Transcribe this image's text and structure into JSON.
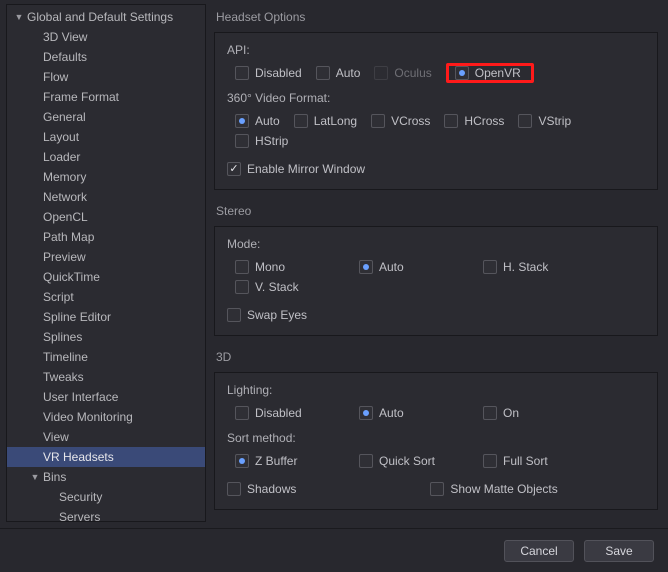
{
  "sidebar": {
    "root": {
      "label": "Global and Default Settings",
      "expanded": true
    },
    "items": [
      "3D View",
      "Defaults",
      "Flow",
      "Frame Format",
      "General",
      "Layout",
      "Loader",
      "Memory",
      "Network",
      "OpenCL",
      "Path Map",
      "Preview",
      "QuickTime",
      "Script",
      "Spline Editor",
      "Splines",
      "Timeline",
      "Tweaks",
      "User Interface",
      "Video Monitoring",
      "View",
      "VR Headsets"
    ],
    "selected": "VR Headsets",
    "bins": {
      "label": "Bins",
      "expanded": true,
      "items": [
        "Security",
        "Servers"
      ]
    }
  },
  "headset": {
    "heading": "Headset Options",
    "api": {
      "label": "API:",
      "options": [
        "Disabled",
        "Auto",
        "Oculus",
        "OpenVR"
      ],
      "disabled_options": [
        "Oculus"
      ],
      "selected": "OpenVR"
    },
    "video": {
      "label": "360° Video Format:",
      "options": [
        "Auto",
        "LatLong",
        "VCross",
        "HCross",
        "VStrip",
        "HStrip"
      ],
      "selected": "Auto"
    },
    "mirror": {
      "label": "Enable Mirror Window",
      "checked": true
    }
  },
  "stereo": {
    "heading": "Stereo",
    "mode": {
      "label": "Mode:",
      "options": [
        "Mono",
        "Auto",
        "H. Stack",
        "V. Stack"
      ],
      "selected": "Auto"
    },
    "swap": {
      "label": "Swap Eyes",
      "checked": false
    }
  },
  "three_d": {
    "heading": "3D",
    "lighting": {
      "label": "Lighting:",
      "options": [
        "Disabled",
        "Auto",
        "On"
      ],
      "selected": "Auto"
    },
    "sort": {
      "label": "Sort method:",
      "options": [
        "Z Buffer",
        "Quick Sort",
        "Full Sort"
      ],
      "selected": "Z Buffer"
    },
    "shadows": {
      "label": "Shadows",
      "checked": false
    },
    "matte": {
      "label": "Show Matte Objects",
      "checked": false
    }
  },
  "footer": {
    "cancel": "Cancel",
    "save": "Save"
  }
}
